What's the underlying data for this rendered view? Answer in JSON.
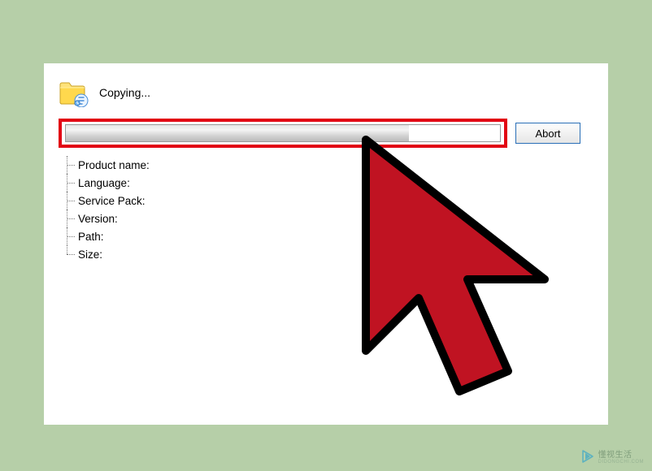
{
  "header": {
    "status_text": "Copying..."
  },
  "progress": {
    "percent": 79,
    "abort_label": "Abort"
  },
  "info": {
    "items": [
      {
        "label": "Product name:"
      },
      {
        "label": "Language:"
      },
      {
        "label": "Service Pack:"
      },
      {
        "label": "Version:"
      },
      {
        "label": "Path:"
      },
      {
        "label": "Size:"
      }
    ]
  },
  "watermark": {
    "text": "懂视生活",
    "sub": "DIDONGCHI.COM"
  }
}
